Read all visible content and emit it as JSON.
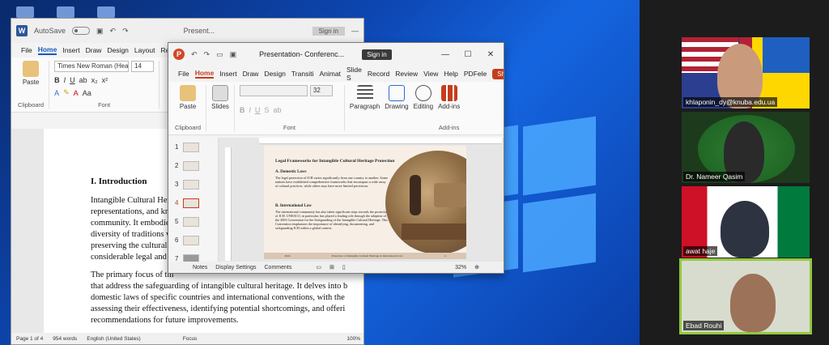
{
  "word": {
    "autosave_label": "AutoSave",
    "autosave_state": "Off",
    "title": "Present...",
    "signin_label": "Sign in",
    "menu": [
      "File",
      "Home",
      "Insert",
      "Draw",
      "Design",
      "Layout",
      "Refere"
    ],
    "active_tab": "Home",
    "font_name": "Times New Roman (Headings",
    "font_size": "14",
    "paste_label": "Paste",
    "clipboard_label": "Clipboard",
    "font_label": "Font",
    "heading": "I. Introduction",
    "para1": [
      "Intangible Cultural Herit",
      "representations, and kno",
      "community. It embodies",
      "diversity of traditions wo",
      "preserving the cultural id",
      "considerable legal and a"
    ],
    "para2": [
      "The primary focus of thi",
      "that address the safeguarding of intangible cultural heritage. It delves into b",
      "domestic laws of specific countries and international conventions, with the",
      "assessing their effectiveness, identifying potential shortcomings, and offeri",
      "recommendations for future improvements."
    ],
    "status": {
      "page": "Page 1 of 4",
      "words": "954 words",
      "language": "English (United States)",
      "focus": "Focus",
      "zoom": "100%"
    }
  },
  "ppt": {
    "title": "Presentation- Conferenc...",
    "signin_label": "Sign in",
    "menu": [
      "File",
      "Home",
      "Insert",
      "Draw",
      "Design",
      "Transiti",
      "Animat",
      "Slide S",
      "Record",
      "Review",
      "View",
      "Help",
      "PDFele"
    ],
    "active_tab": "Home",
    "share_label": "Share",
    "ribbon": {
      "paste": "Paste",
      "slides": "Slides",
      "paragraph": "Paragraph",
      "drawing": "Drawing",
      "editing": "Editing",
      "addins": "Add-ins",
      "clipboard": "Clipboard",
      "font": "Font",
      "addins_group": "Add-ins",
      "font_size": "32"
    },
    "thumbnails": [
      "1",
      "2",
      "3",
      "4",
      "5",
      "6",
      "7"
    ],
    "selected_slide": "4",
    "slide": {
      "title": "Legal Frameworks for Intangible Cultural Heritage Protection",
      "h1": "A. Domestic Laws",
      "p1": "The legal protection of ICH varies significantly from one country to another. Some nations have established comprehensive frameworks that encompass a wide array of cultural practices, while others may have more limited provisions.",
      "h2": "B. International Law",
      "p2": "The international community has also taken significant steps towards the protection of ICH. UNESCO, in particular, has played a leading role through the adoption of the 2003 Convention for the Safeguarding of the Intangible Cultural Heritage. This Convention emphasizes the importance of identifying, documenting, and safeguarding ICH within a global context.",
      "footer_left": "2024",
      "footer_mid": "Protection of Intangible Cultural Heritage in International Law",
      "footer_right": "4"
    },
    "status": {
      "notes": "Notes",
      "display": "Display Settings",
      "comments": "Comments",
      "zoom": "32%"
    }
  },
  "participants": [
    {
      "name": "khlaponin_dy@knuba.edu.ua",
      "active": false
    },
    {
      "name": "Dr. Nameer Qasim",
      "active": false
    },
    {
      "name": "awat haje",
      "active": false
    },
    {
      "name": "Ebad Rouhi",
      "active": true
    }
  ],
  "colors": {
    "ppt_accent": "#c43e1c",
    "word_accent": "#185abd",
    "active_speaker": "#92c83e"
  }
}
